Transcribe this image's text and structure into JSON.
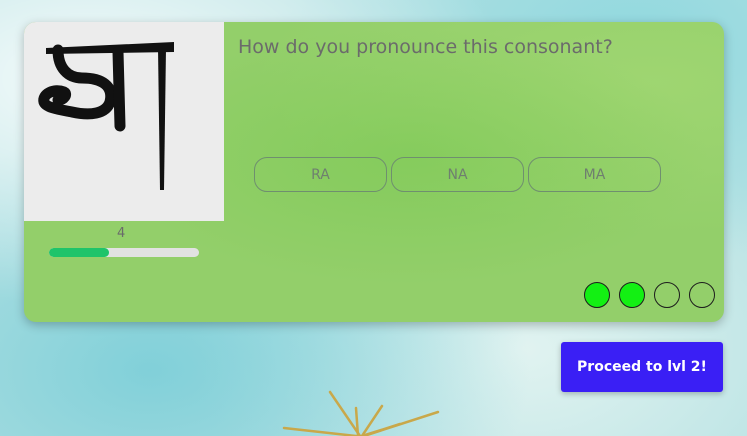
{
  "question": "How do you pronounce this consonant?",
  "options": [
    "RA",
    "NA",
    "MA"
  ],
  "progress": {
    "level_label": "4",
    "fill_fraction": 0.4
  },
  "attempts": [
    true,
    true,
    false,
    false
  ],
  "proceed_label": "Proceed to lvl 2!",
  "glyph": "tibetan-letter-ma",
  "colors": {
    "card": "#93cf6a",
    "progress_fill": "#1fc46a",
    "dot_on": "#13f013",
    "proceed": "#3a1ff5"
  }
}
